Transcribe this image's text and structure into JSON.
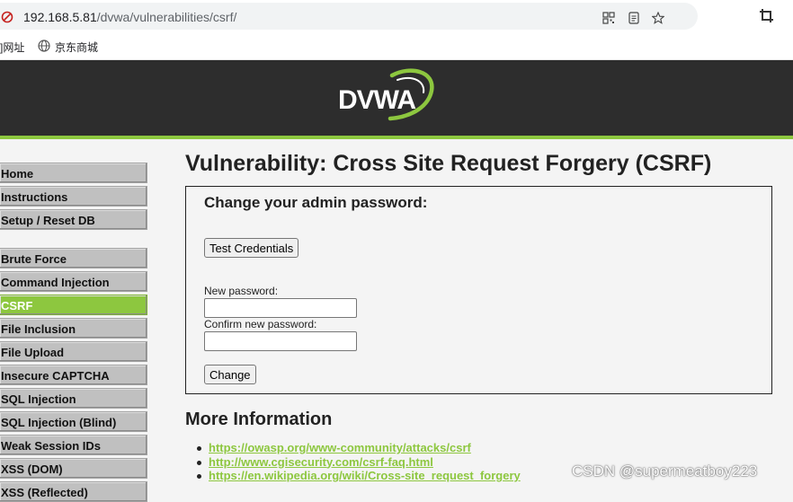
{
  "browser": {
    "url_host": "192.168.5.81",
    "url_path": "/dvwa/vulnerabilities/csrf/",
    "bookmarks": [
      "]网址",
      "京东商城"
    ]
  },
  "header": {
    "logo_text": "DVWA",
    "brand_color": "#8dc73f",
    "header_bg": "#2d2d2d"
  },
  "menu": {
    "group1": [
      "Home",
      "Instructions",
      "Setup / Reset DB"
    ],
    "group2": [
      "Brute Force",
      "Command Injection",
      "CSRF",
      "File Inclusion",
      "File Upload",
      "Insecure CAPTCHA",
      "SQL Injection",
      "SQL Injection (Blind)",
      "Weak Session IDs",
      "XSS (DOM)",
      "XSS (Reflected)"
    ],
    "active": "CSRF"
  },
  "main": {
    "title": "Vulnerability: Cross Site Request Forgery (CSRF)",
    "form": {
      "heading": "Change your admin password:",
      "test_button": "Test Credentials",
      "new_password_label": "New password:",
      "new_password_value": "",
      "confirm_password_label": "Confirm new password:",
      "confirm_password_value": "",
      "change_button": "Change"
    },
    "more_info": {
      "heading": "More Information",
      "links": [
        "https://owasp.org/www-community/attacks/csrf",
        "http://www.cgisecurity.com/csrf-faq.html",
        "https://en.wikipedia.org/wiki/Cross-site_request_forgery"
      ]
    }
  },
  "watermark": "CSDN @supermeatboy223"
}
